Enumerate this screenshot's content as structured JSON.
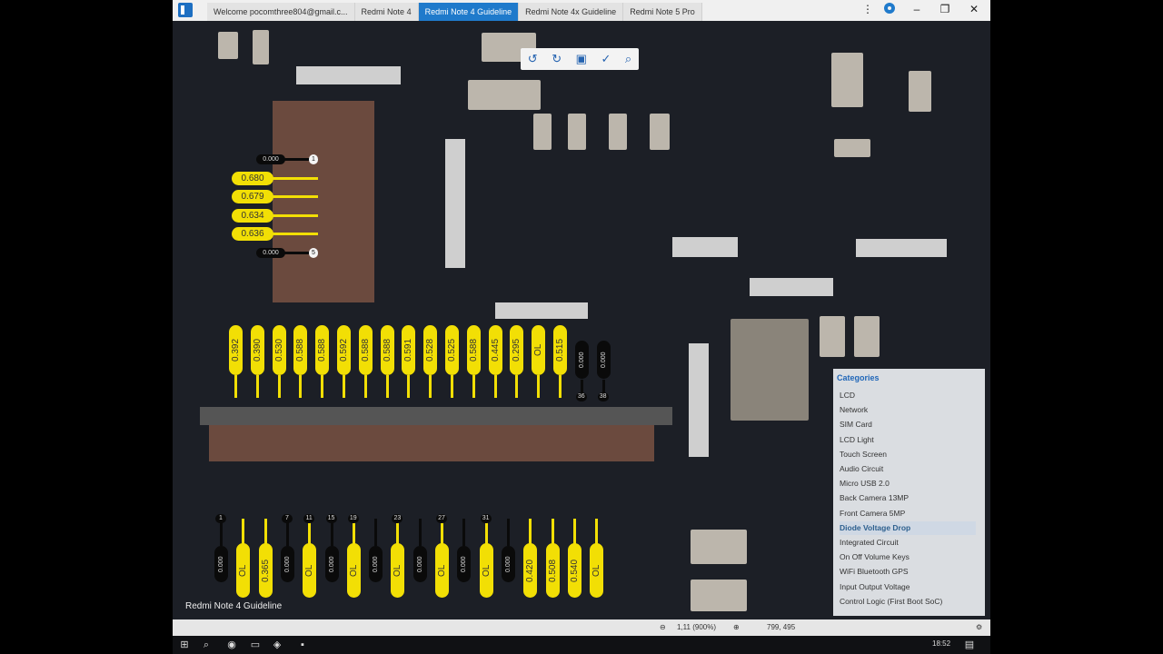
{
  "tabs": [
    {
      "label": "Welcome pocomthree804@gmail.c..."
    },
    {
      "label": "Redmi Note 4"
    },
    {
      "label": "Redmi Note 4 Guideline"
    },
    {
      "label": "Redmi Note 4x Guideline"
    },
    {
      "label": "Redmi Note 5 Pro"
    }
  ],
  "active_tab_index": 2,
  "window_controls": {
    "menu": "⋮",
    "minimize": "–",
    "restore": "❐",
    "close": "✕"
  },
  "toolbar_icons": [
    "rotate-left-icon",
    "rotate-right-icon",
    "fit-screen-icon",
    "measure-icon",
    "search-icon"
  ],
  "left_connector_labels": [
    {
      "pin": "1",
      "value": "0.000",
      "style": "black"
    },
    {
      "pin": "",
      "value": "0.680",
      "style": "yellow"
    },
    {
      "pin": "",
      "value": "0.679",
      "style": "yellow"
    },
    {
      "pin": "",
      "value": "0.634",
      "style": "yellow"
    },
    {
      "pin": "",
      "value": "0.636",
      "style": "yellow"
    },
    {
      "pin": "5",
      "value": "0.000",
      "style": "black"
    }
  ],
  "top_row_labels": [
    "0.392",
    "0.390",
    "0.530",
    "0.588",
    "0.588",
    "0.592",
    "0.588",
    "0.588",
    "0.591",
    "0.528",
    "0.525",
    "0.588",
    "0.445",
    "0.295",
    "OL",
    "0.515",
    "0.000",
    "0.000"
  ],
  "top_row_pin_numbers": {
    "16": "36",
    "17": "38"
  },
  "bottom_row_labels": [
    "0.000",
    "OL",
    "0.365",
    "0.000",
    "OL",
    "0.000",
    "OL",
    "0.000",
    "OL",
    "0.000",
    "OL",
    "0.000",
    "OL",
    "0.000",
    "0.420",
    "0.508",
    "0.540",
    "OL"
  ],
  "bottom_row_pin_numbers": {
    "0": "1",
    "3": "7",
    "4": "11",
    "5": "15",
    "6": "19",
    "8": "23",
    "10": "27",
    "12": "31"
  },
  "board_caption": "Redmi Note 4 Guideline",
  "categories": {
    "title": "Categories",
    "items": [
      "LCD",
      "Network",
      "SIM Card",
      "LCD Light",
      "Touch Screen",
      "Audio Circuit",
      "Micro USB 2.0",
      "Back Camera 13MP",
      "Front Camera 5MP",
      "Diode Voltage Drop",
      "Integrated Circuit",
      "On Off Volume Keys",
      "WiFi Bluetooth GPS",
      "Input Output Voltage",
      "Control Logic (First Boot SoC)"
    ],
    "selected_index": 9
  },
  "status": {
    "zoom": "1,11 (900%)",
    "coords": "799, 495"
  },
  "taskbar": {
    "time": "18:52"
  },
  "colors": {
    "accent": "#1f7acb",
    "label_yellow": "#f2df05",
    "board": "#1c1f26",
    "connector_brown": "#6b4a3e"
  }
}
